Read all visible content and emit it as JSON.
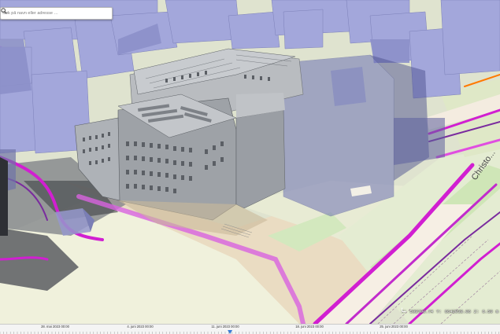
{
  "search": {
    "placeholder": "Søk på navn eller adresse …",
    "icon": "search-icon"
  },
  "scene": {
    "description_icon": "3d-city-view",
    "colors": {
      "ground": "#eef0d8",
      "plaza": "#e9dcc3",
      "building_ghost": "#9a9fd6",
      "model_gray": "#8c9094",
      "utility_magenta": "#d11fd1",
      "utility_purple": "#7a2b9e",
      "road": "#f6efe6",
      "grass": "#cde8b8"
    },
    "street_label": "Christo..."
  },
  "coordinates": {
    "x_label": "X:",
    "x_value": "598790.74",
    "y_label": "Y:",
    "y_value": "6642038.06",
    "z_label": "Z:",
    "z_value": "6.50",
    "unit": "m"
  },
  "timeline": {
    "labels": [
      "28. mai 2023 00:00",
      "4. juni 2023 00:00",
      "11. juni 2023 00:00",
      "18. juni 2023 00:00",
      "25. juni 2023 00:00"
    ],
    "marker_position_fraction": 0.46
  }
}
